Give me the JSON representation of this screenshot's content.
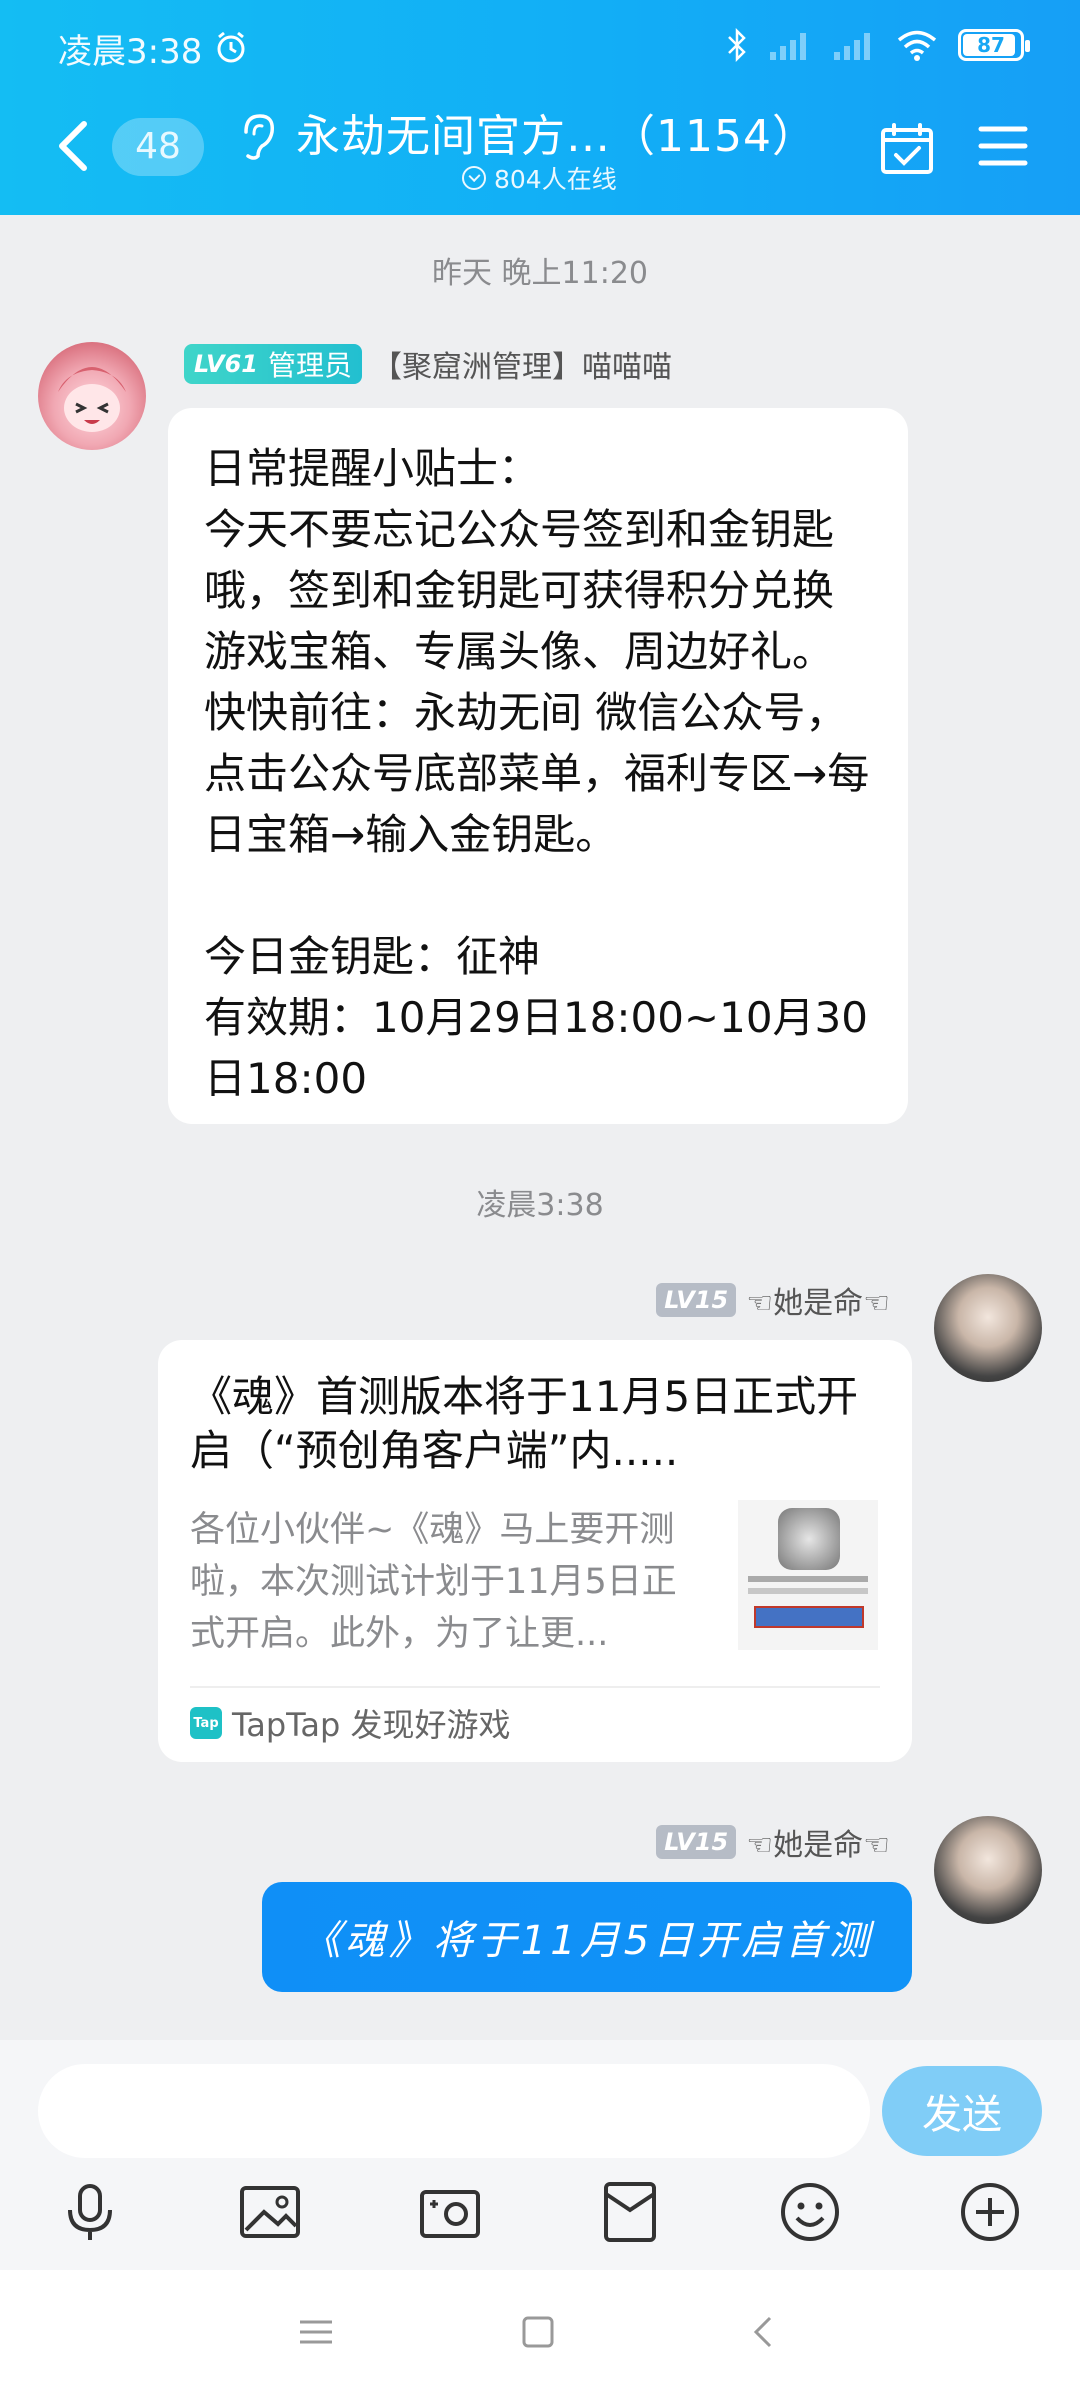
{
  "status": {
    "time": "凌晨3:38",
    "battery": "87"
  },
  "header": {
    "unread_count": "48",
    "title": "永劫无间官方…（1154）",
    "online": "804人在线"
  },
  "messages": {
    "ts1": "昨天 晚上11:20",
    "msg1": {
      "level": "LV61",
      "role": "管理员",
      "sender": "【聚窟洲管理】喵喵喵",
      "text": "日常提醒小贴士：\n今天不要忘记公众号签到和金钥匙哦，签到和金钥匙可获得积分兑换游戏宝箱、专属头像、周边好礼。快快前往：永劫无间 微信公众号，点击公众号底部菜单，福利专区→每日宝箱→输入金钥匙。\n\n今日金钥匙：征神\n有效期：10月29日18:00~10月30日18:00"
    },
    "ts2": "凌晨3:38",
    "msg2": {
      "level": "LV15",
      "sender": "☜她是命☜",
      "card_title": "《魂》首测版本将于11月5日正式开启（“预创角客户端”内.....",
      "card_desc": "各位小伙伴~《魂》马上要开测啦，本次测试计划于11月5日正式开启。此外，为了让更...",
      "card_source": "TapTap 发现好游戏",
      "tap_logo": "Tap"
    },
    "msg3": {
      "level": "LV15",
      "sender": "☜她是命☜",
      "text": "《魂》将于11月5日开启首测"
    }
  },
  "input": {
    "placeholder": "",
    "send_label": "发送"
  },
  "icons": [
    "microphone-icon",
    "image-icon",
    "camera-icon",
    "red-packet-icon",
    "emoji-icon",
    "plus-icon"
  ],
  "colors": {
    "header": "#12aef6",
    "bubble_blue": "#0f8ff7",
    "send_button": "#80cdf7"
  }
}
